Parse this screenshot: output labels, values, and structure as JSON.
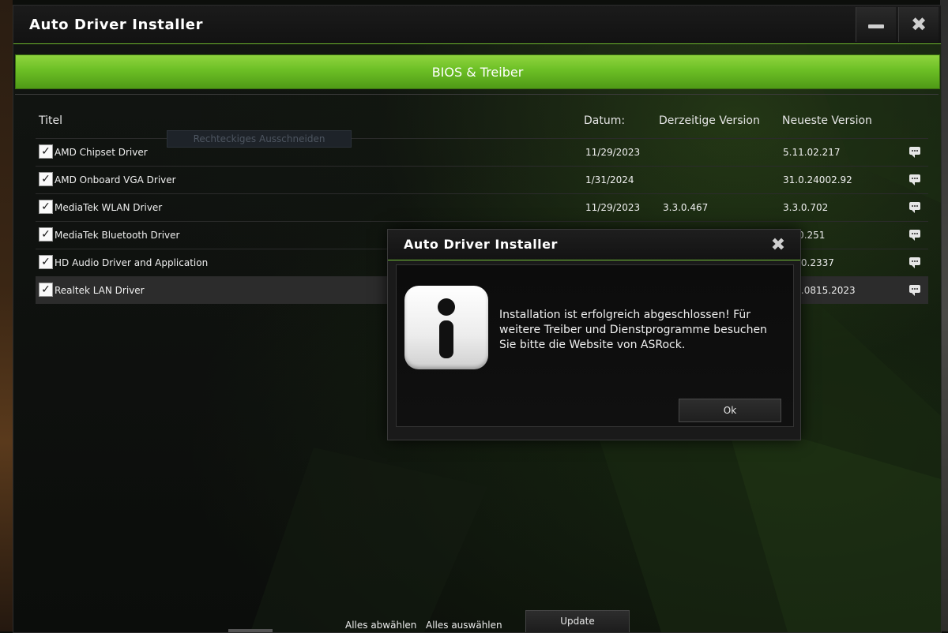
{
  "window": {
    "title": "Auto Driver Installer",
    "minimize_icon": "minimize-icon",
    "close_icon": "close-icon"
  },
  "section_header": "BIOS & Treiber",
  "table": {
    "headers": {
      "title": "Titel",
      "date": "Datum:",
      "current_version": "Derzeitige Version",
      "latest_version": "Neueste Version"
    },
    "rows": [
      {
        "checked": true,
        "name": "AMD Chipset Driver",
        "date": "11/29/2023",
        "current": "",
        "latest": "5.11.02.217"
      },
      {
        "checked": true,
        "name": "AMD Onboard VGA Driver",
        "date": "1/31/2024",
        "current": "",
        "latest": "31.0.24002.92"
      },
      {
        "checked": true,
        "name": "MediaTek WLAN Driver",
        "date": "11/29/2023",
        "current": "3.3.0.467",
        "latest": "3.3.0.702"
      },
      {
        "checked": true,
        "name": "MediaTek Bluetooth Driver",
        "date": "",
        "current": "",
        "latest": "30.0.251"
      },
      {
        "checked": true,
        "name": "HD Audio Driver and Application",
        "date": "",
        "current": "",
        "latest": "9600.2337"
      },
      {
        "checked": true,
        "name": "Realtek LAN Driver",
        "date": "",
        "current": "",
        "latest": "068.0815.2023"
      }
    ]
  },
  "ghost_tooltip": "Rechteckiges Ausschneiden",
  "footer": {
    "deselect_all": "Alles abwählen",
    "select_all": "Alles auswählen",
    "update": "Update"
  },
  "dialog": {
    "title": "Auto Driver Installer",
    "message": "Installation ist erfolgreich abgeschlossen! Für weitere Treiber und Dienstprogramme besuchen Sie bitte die Website von ASRock.",
    "ok": "Ok",
    "icon": "info-icon"
  },
  "colors": {
    "accent_green": "#6cbf25",
    "background": "#0c0e0b"
  }
}
